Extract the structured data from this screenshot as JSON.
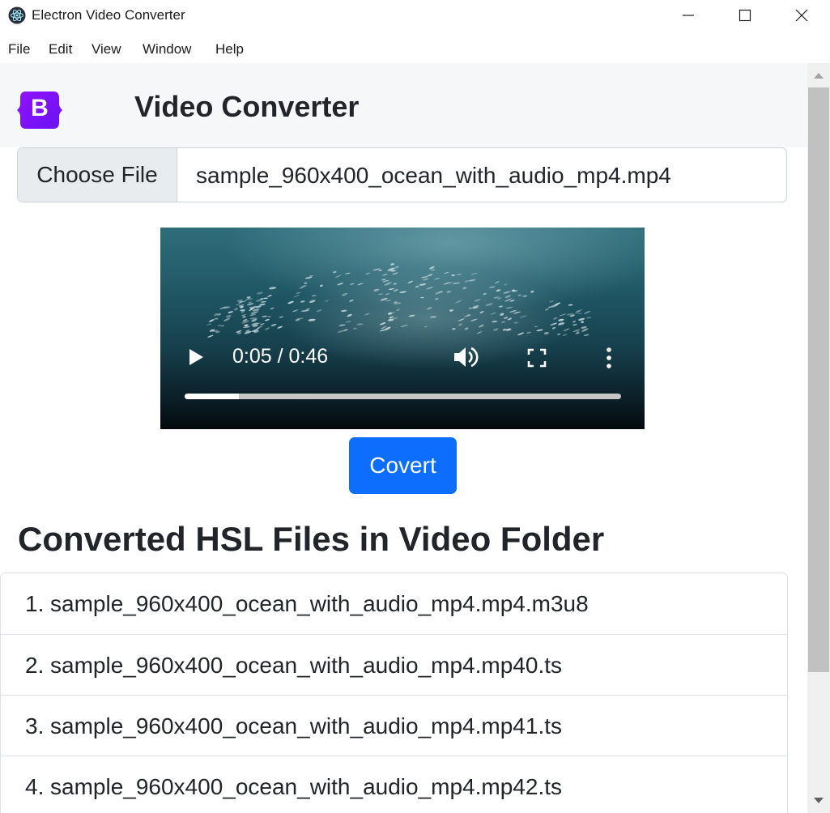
{
  "window": {
    "title": "Electron Video Converter",
    "app_icon": "electron-icon",
    "controls": [
      "minimize-icon",
      "maximize-icon",
      "close-icon"
    ]
  },
  "menu": {
    "items": [
      "File",
      "Edit",
      "View",
      "Window",
      "Help"
    ]
  },
  "header": {
    "logo_icon": "bootstrap-logo-icon",
    "logo_letter": "B",
    "title": "Video Converter"
  },
  "file_input": {
    "button_label": "Choose File",
    "value": "sample_960x400_ocean_with_audio_mp4.mp4"
  },
  "video": {
    "time": "0:05 / 0:46",
    "progress": 0.125,
    "icons": [
      "play-icon",
      "volume-icon",
      "fullscreen-icon",
      "more-options-icon"
    ]
  },
  "convert_button": {
    "label": "Covert",
    "color": "#0d6efd"
  },
  "converted": {
    "heading": "Converted HSL Files in Video Folder",
    "files": [
      {
        "num": "1.",
        "name": "sample_960x400_ocean_with_audio_mp4.mp4.m3u8"
      },
      {
        "num": "2.",
        "name": "sample_960x400_ocean_with_audio_mp4.mp40.ts"
      },
      {
        "num": "3.",
        "name": "sample_960x400_ocean_with_audio_mp4.mp41.ts"
      },
      {
        "num": "4.",
        "name": "sample_960x400_ocean_with_audio_mp4.mp42.ts"
      }
    ]
  },
  "colors": {
    "brand_purple": "#7952b3",
    "primary": "#0d6efd",
    "header_bg": "#f6f7f8"
  }
}
